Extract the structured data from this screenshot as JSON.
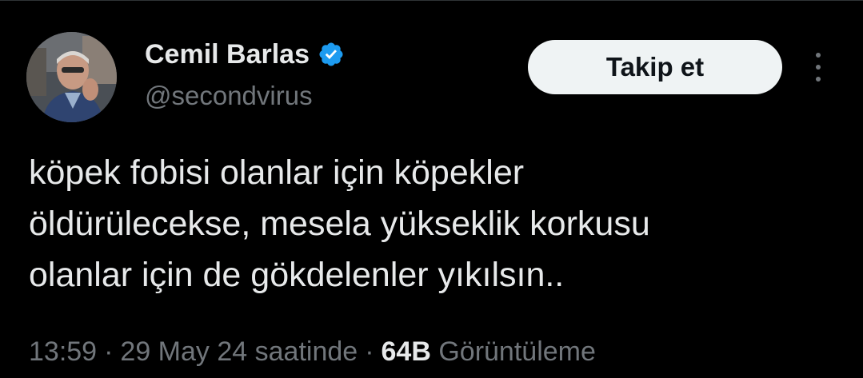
{
  "author": {
    "display_name": "Cemil Barlas",
    "handle": "@secondvirus",
    "verified": true,
    "verified_color": "#1d9bf0"
  },
  "actions": {
    "follow_label": "Takip et",
    "more_icon": "more-vertical-icon"
  },
  "tweet": {
    "lines": [
      "köpek fobisi olanlar için köpekler",
      "öldürülecekse, mesela yükseklik korkusu",
      "olanlar için de gökdelenler yıkılsın.."
    ]
  },
  "meta": {
    "time": "13:59",
    "date": "29 May 24 saatinde",
    "separator": "·",
    "views_count": "64B",
    "views_label": "Görüntüleme"
  },
  "colors": {
    "background": "#000000",
    "primary_text": "#e7e9ea",
    "secondary_text": "#71767b",
    "button_bg": "#eff3f4",
    "button_text": "#0f1419",
    "accent": "#1d9bf0"
  }
}
